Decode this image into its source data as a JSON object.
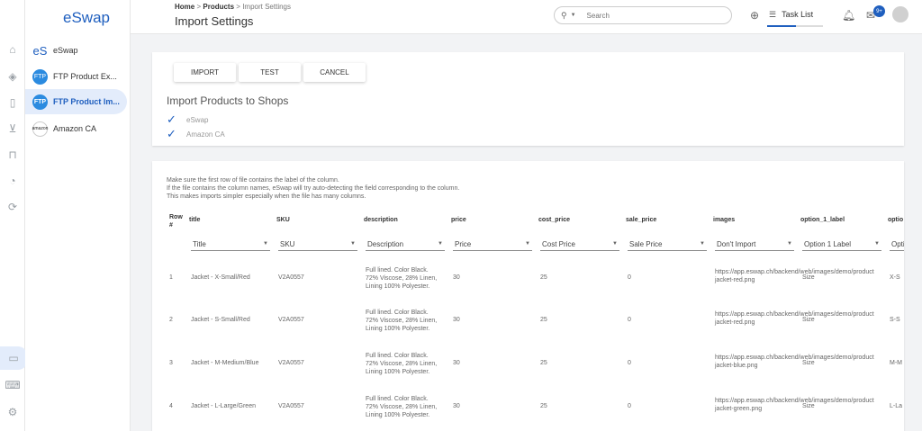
{
  "app": {
    "logo": "eSwap"
  },
  "rail": [
    "home-icon",
    "layers-icon",
    "book-icon",
    "cart-icon",
    "inbox-icon",
    "pie-chart-icon",
    "sync-icon",
    "tablet-icon",
    "laptop-icon",
    "settings-icon"
  ],
  "shops": [
    {
      "label": "eSwap",
      "icon": "eS"
    },
    {
      "label": "FTP Product Ex...",
      "icon": "ftp"
    },
    {
      "label": "FTP Product Im...",
      "icon": "ftp",
      "active": true
    },
    {
      "label": "Amazon CA",
      "icon": "amazon"
    }
  ],
  "header": {
    "breadcrumb_home": "Home",
    "breadcrumb_sep1": ">",
    "breadcrumb_products": "Products",
    "breadcrumb_sep2": ">",
    "breadcrumb_current": "Import Settings",
    "title": "Import Settings",
    "search_placeholder": "Search",
    "task_list": "Task List",
    "notification_badge": "9+"
  },
  "actions": {
    "import": "IMPORT",
    "test": "TEST",
    "cancel": "CANCEL"
  },
  "import_to": {
    "heading": "Import Products to Shops",
    "shops": [
      "eSwap",
      "Amazon CA"
    ]
  },
  "notes": [
    "Make sure the first row of file contains the label of the column.",
    "If the file contains the column names, eSwap will try auto-detecting the field corresponding to the column.",
    "This makes imports simpler especially when the file has many columns."
  ],
  "table": {
    "rownum_header": [
      "Row",
      "#"
    ],
    "columns": [
      "title",
      "SKU",
      "description",
      "price",
      "cost_price",
      "sale_price",
      "images",
      "option_1_label",
      "optio"
    ],
    "mappings": [
      "Title",
      "SKU",
      "Description",
      "Price",
      "Cost Price",
      "Sale Price",
      "Don't Import",
      "Option 1 Label",
      "Opti"
    ],
    "rows": [
      {
        "n": "1",
        "title": "Jacket - X-Small/Red",
        "sku": "V2A0557",
        "desc": [
          "Full lined. Color Black.",
          "72% Viscose, 28% Linen,",
          "Lining 100% Polyester."
        ],
        "price": "30",
        "cost": "25",
        "sale": "0",
        "img": [
          "https://app.eswap.ch/backend/web/images/demo/product",
          "jacket-red.png"
        ],
        "opt": "Size",
        "opt2": "X-S"
      },
      {
        "n": "2",
        "title": "Jacket - S-Small/Red",
        "sku": "V2A0557",
        "desc": [
          "Full lined. Color Black.",
          "72% Viscose, 28% Linen,",
          "Lining 100% Polyester."
        ],
        "price": "30",
        "cost": "25",
        "sale": "0",
        "img": [
          "https://app.eswap.ch/backend/web/images/demo/product",
          "jacket-red.png"
        ],
        "opt": "Size",
        "opt2": "S-S"
      },
      {
        "n": "3",
        "title": "Jacket - M-Medium/Blue",
        "sku": "V2A0557",
        "desc": [
          "Full lined. Color Black.",
          "72% Viscose, 28% Linen,",
          "Lining 100% Polyester."
        ],
        "price": "30",
        "cost": "25",
        "sale": "0",
        "img": [
          "https://app.eswap.ch/backend/web/images/demo/product",
          "jacket-blue.png"
        ],
        "opt": "Size",
        "opt2": "M-M"
      },
      {
        "n": "4",
        "title": "Jacket - L-Large/Green",
        "sku": "V2A0557",
        "desc": [
          "Full lined. Color Black.",
          "72% Viscose, 28% Linen,",
          "Lining 100% Polyester."
        ],
        "price": "30",
        "cost": "25",
        "sale": "0",
        "img": [
          "https://app.eswap.ch/backend/web/images/demo/product",
          "jacket-green.png"
        ],
        "opt": "Size",
        "opt2": "L-La"
      }
    ]
  },
  "colors": {
    "accent": "#1f5fbf",
    "active_bg": "#e3ecfb"
  }
}
